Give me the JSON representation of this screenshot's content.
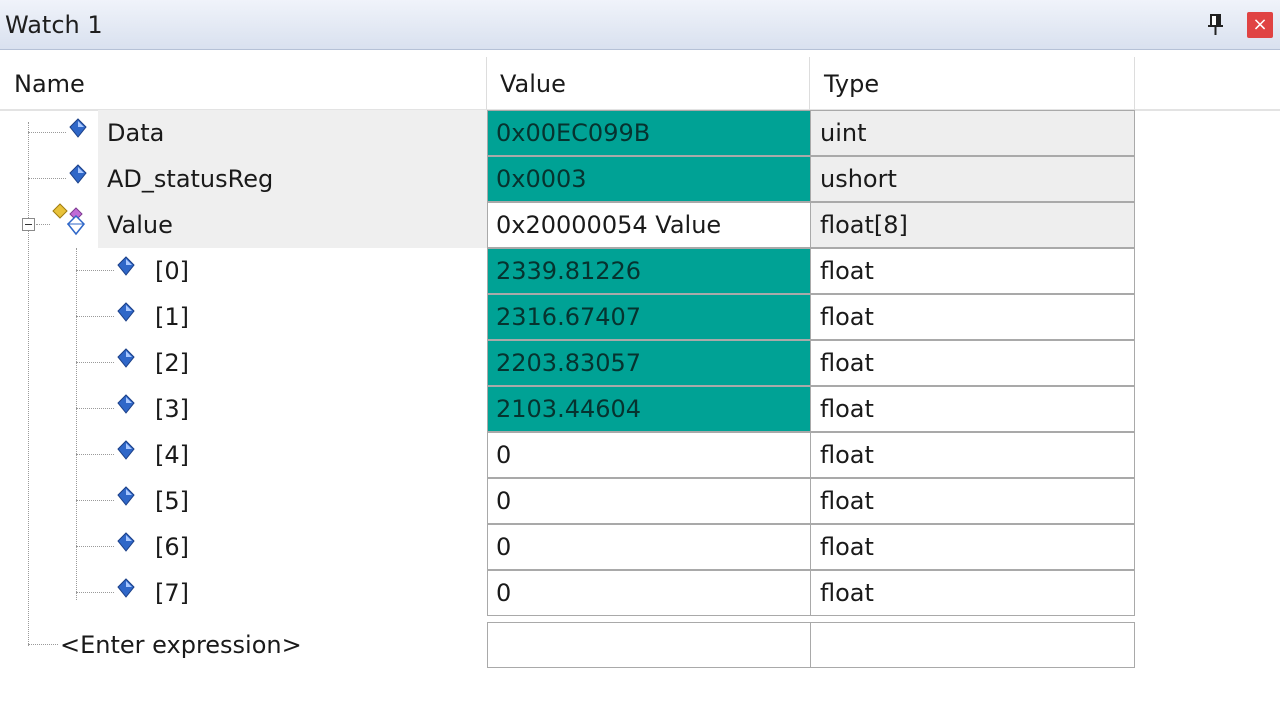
{
  "window": {
    "title": "Watch 1",
    "pin_icon": "pin-icon",
    "close_icon": "close-icon",
    "close_glyph": "×"
  },
  "columns": {
    "name": "Name",
    "value": "Value",
    "type": "Type"
  },
  "rows": [
    {
      "name": "Data",
      "value": "0x00EC099B",
      "type": "uint",
      "changed": true
    },
    {
      "name": "AD_statusReg",
      "value": "0x0003",
      "type": "ushort",
      "changed": true
    },
    {
      "name": "Value",
      "value": "0x20000054 Value",
      "type": "float[8]",
      "changed": false,
      "expanded": true,
      "children": [
        {
          "name": "[0]",
          "value": "2339.81226",
          "type": "float",
          "changed": true
        },
        {
          "name": "[1]",
          "value": "2316.67407",
          "type": "float",
          "changed": true
        },
        {
          "name": "[2]",
          "value": "2203.83057",
          "type": "float",
          "changed": true
        },
        {
          "name": "[3]",
          "value": "2103.44604",
          "type": "float",
          "changed": true
        },
        {
          "name": "[4]",
          "value": "0",
          "type": "float",
          "changed": false
        },
        {
          "name": "[5]",
          "value": "0",
          "type": "float",
          "changed": false
        },
        {
          "name": "[6]",
          "value": "0",
          "type": "float",
          "changed": false
        },
        {
          "name": "[7]",
          "value": "0",
          "type": "float",
          "changed": false
        }
      ]
    }
  ],
  "enter_expression": "<Enter expression>",
  "colors": {
    "changed_value_bg": "#00a295",
    "titlebar": "#d9e1ef",
    "close_button": "#e04343"
  }
}
